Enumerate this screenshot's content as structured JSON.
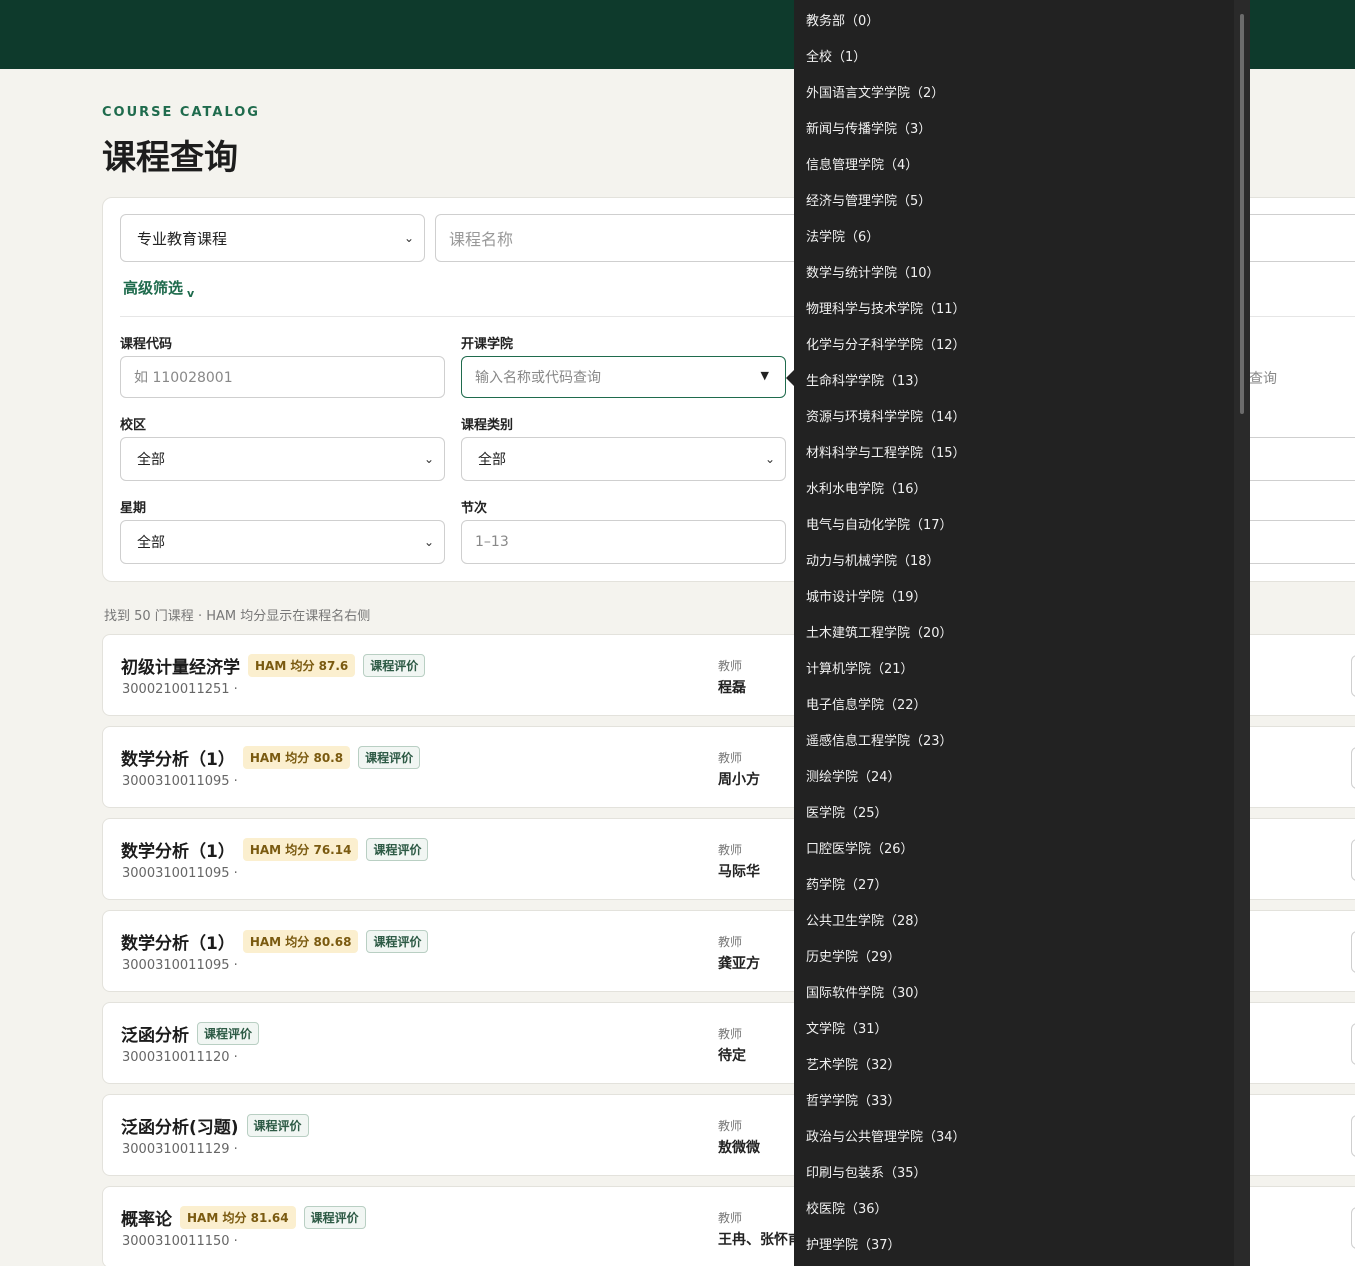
{
  "header": {
    "eyebrow": "COURSE CATALOG",
    "title": "课程查询"
  },
  "search": {
    "course_type": "专业教育课程",
    "name_placeholder": "课程名称",
    "advanced_label": "高级筛选",
    "advanced_chevron": "v",
    "right_partial": "查询"
  },
  "filters": {
    "code_label": "课程代码",
    "code_placeholder": "如 110028001",
    "college_label": "开课学院",
    "college_placeholder": "输入名称或代码查询",
    "campus_label": "校区",
    "campus_value": "全部",
    "category_label": "课程类别",
    "category_value": "全部",
    "weekday_label": "星期",
    "weekday_value": "全部",
    "period_label": "节次",
    "period_placeholder": "1–13"
  },
  "results": {
    "summary": "找到 50 门课程 · HAM 均分显示在课程名右侧",
    "teacher_label": "教师",
    "eval_label": "课程评价",
    "courses": [
      {
        "name": "初级计量经济学",
        "ham": "HAM 均分 87.6",
        "code": "3000210011251 ·",
        "teacher": "程磊"
      },
      {
        "name": "数学分析（1）",
        "ham": "HAM 均分 80.8",
        "code": "3000310011095 ·",
        "teacher": "周小方"
      },
      {
        "name": "数学分析（1）",
        "ham": "HAM 均分 76.14",
        "code": "3000310011095 ·",
        "teacher": "马际华"
      },
      {
        "name": "数学分析（1）",
        "ham": "HAM 均分 80.68",
        "code": "3000310011095 ·",
        "teacher": "龚亚方"
      },
      {
        "name": "泛函分析",
        "ham": "",
        "code": "3000310011120 ·",
        "teacher": "待定"
      },
      {
        "name": "泛函分析(习题)",
        "ham": "",
        "code": "3000310011129 ·",
        "teacher": "敖微微"
      },
      {
        "name": "概率论",
        "ham": "HAM 均分 81.64",
        "code": "3000310011150 ·",
        "teacher": "王冉、张怀甫"
      }
    ]
  },
  "dropdown": {
    "items": [
      "教务部（0）",
      "全校（1）",
      "外国语言文学学院（2）",
      "新闻与传播学院（3）",
      "信息管理学院（4）",
      "经济与管理学院（5）",
      "法学院（6）",
      "数学与统计学院（10）",
      "物理科学与技术学院（11）",
      "化学与分子科学学院（12）",
      "生命科学学院（13）",
      "资源与环境科学学院（14）",
      "材料科学与工程学院（15）",
      "水利水电学院（16）",
      "电气与自动化学院（17）",
      "动力与机械学院（18）",
      "城市设计学院（19）",
      "土木建筑工程学院（20）",
      "计算机学院（21）",
      "电子信息学院（22）",
      "遥感信息工程学院（23）",
      "测绘学院（24）",
      "医学院（25）",
      "口腔医学院（26）",
      "药学院（27）",
      "公共卫生学院（28）",
      "历史学院（29）",
      "国际软件学院（30）",
      "文学院（31）",
      "艺术学院（32）",
      "哲学学院（33）",
      "政治与公共管理学院（34）",
      "印刷与包装系（35）",
      "校医院（36）",
      "护理学院（37）"
    ]
  },
  "colors": {
    "brand": "#0e3a2c",
    "accent": "#1f6b4d",
    "ham_bg": "#fbefcf"
  }
}
